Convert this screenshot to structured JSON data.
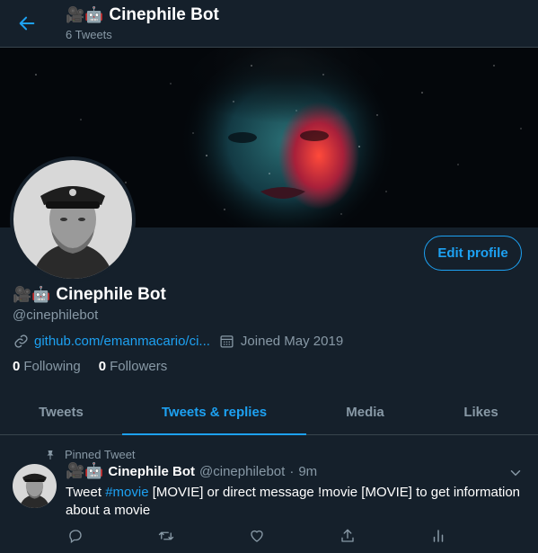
{
  "header": {
    "title": "Cinephile Bot",
    "title_emoji": "🎥🤖",
    "tweet_count": "6 Tweets"
  },
  "profile": {
    "name": "Cinephile Bot",
    "name_emoji": "🎥🤖",
    "handle": "@cinephilebot",
    "link": "github.com/emanmacario/ci...",
    "joined": "Joined May 2019",
    "edit_label": "Edit profile",
    "following_count": "0",
    "following_label": "Following",
    "followers_count": "0",
    "followers_label": "Followers"
  },
  "tabs": [
    {
      "label": "Tweets"
    },
    {
      "label": "Tweets & replies"
    },
    {
      "label": "Media"
    },
    {
      "label": "Likes"
    }
  ],
  "tweet": {
    "pinned_label": "Pinned Tweet",
    "name": "Cinephile Bot",
    "name_emoji": "🎥🤖",
    "handle": "@cinephilebot",
    "dot": "·",
    "time": "9m",
    "text_before": "Tweet ",
    "hashtag": "#movie",
    "text_after": " [MOVIE] or direct message !movie [MOVIE] to get information about a movie"
  },
  "colors": {
    "background": "#15202b",
    "accent": "#1da1f2",
    "secondary_text": "#8899a6",
    "border": "#38444d"
  },
  "icons": [
    "back-arrow-icon",
    "link-icon",
    "calendar-icon",
    "pin-icon",
    "chevron-down-icon",
    "reply-icon",
    "retweet-icon",
    "like-icon",
    "share-icon",
    "analytics-icon"
  ]
}
